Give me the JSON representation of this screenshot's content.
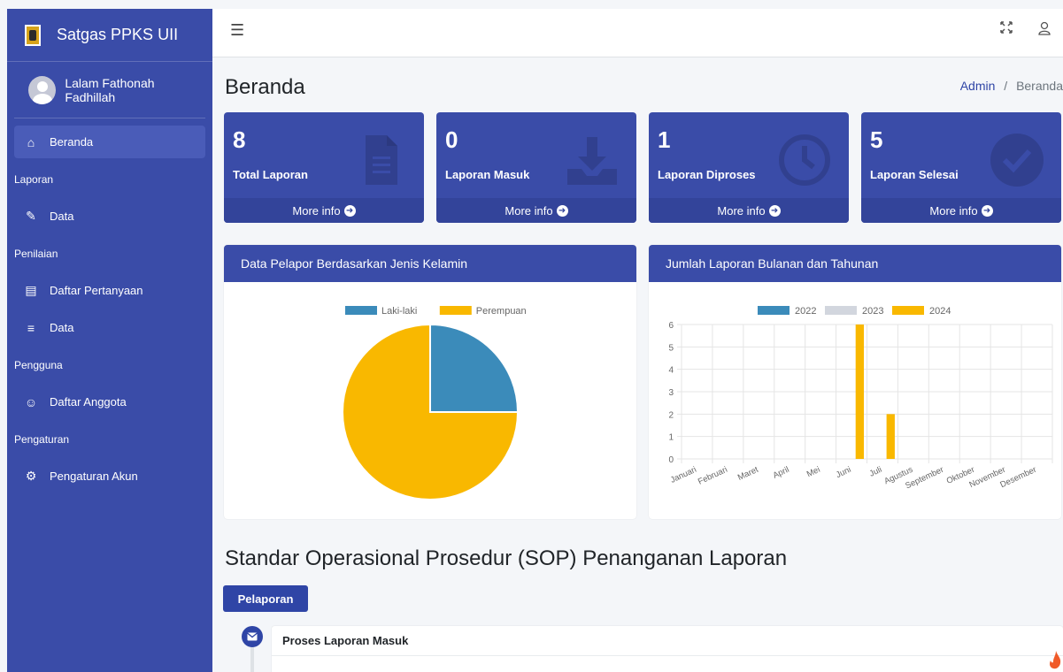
{
  "sidebar": {
    "brand": "Satgas PPKS UII",
    "user": "Lalam Fathonah Fadhillah",
    "items": [
      {
        "type": "item",
        "label": "Beranda",
        "icon": "home-icon",
        "active": true
      },
      {
        "type": "header",
        "label": "Laporan"
      },
      {
        "type": "item",
        "label": "Data",
        "icon": "chart-edit-icon"
      },
      {
        "type": "header",
        "label": "Penilaian"
      },
      {
        "type": "item",
        "label": "Daftar Pertanyaan",
        "icon": "clipboard-icon"
      },
      {
        "type": "item",
        "label": "Data",
        "icon": "database-icon"
      },
      {
        "type": "header",
        "label": "Pengguna"
      },
      {
        "type": "item",
        "label": "Daftar Anggota",
        "icon": "user-cog-icon"
      },
      {
        "type": "header",
        "label": "Pengaturan"
      },
      {
        "type": "item",
        "label": "Pengaturan Akun",
        "icon": "gear-icon"
      }
    ]
  },
  "topbar": {
    "menu_icon": "hamburger-icon",
    "fullscreen_icon": "expand-icon",
    "user_icon": "user-icon"
  },
  "page": {
    "title": "Beranda",
    "breadcrumb": {
      "link": "Admin",
      "separator": "/",
      "current": "Beranda"
    }
  },
  "boxes": [
    {
      "count": "8",
      "label": "Total Laporan",
      "icon": "file-icon"
    },
    {
      "count": "0",
      "label": "Laporan Masuk",
      "icon": "download-icon"
    },
    {
      "count": "1",
      "label": "Laporan Diproses",
      "icon": "clock-icon"
    },
    {
      "count": "5",
      "label": "Laporan Selesai",
      "icon": "check-circle-icon"
    }
  ],
  "more_info": "More info",
  "charts": {
    "gender": {
      "title": "Data Pelapor Berdasarkan Jenis Kelamin"
    },
    "monthly": {
      "title": "Jumlah Laporan Bulanan dan Tahunan"
    }
  },
  "chart_data": [
    {
      "type": "pie",
      "labels": [
        "Laki-laki",
        "Perempuan"
      ],
      "values": [
        2,
        6
      ],
      "colors": [
        "#3b8bba",
        "#f9b800"
      ],
      "legend": "top"
    },
    {
      "type": "bar",
      "categories": [
        "Januari",
        "Februari",
        "Maret",
        "April",
        "Mei",
        "Juni",
        "Juli",
        "Agustus",
        "September",
        "Oktober",
        "November",
        "Desember"
      ],
      "series": [
        {
          "name": "2022",
          "color": "#3b8bba",
          "values": [
            0,
            0,
            0,
            0,
            0,
            0,
            0,
            0,
            0,
            0,
            0,
            0
          ]
        },
        {
          "name": "2023",
          "color": "#d2d6de",
          "values": [
            0,
            0,
            0,
            0,
            0,
            0,
            0,
            0,
            0,
            0,
            0,
            0
          ]
        },
        {
          "name": "2024",
          "color": "#f9b800",
          "values": [
            0,
            0,
            0,
            0,
            0,
            6,
            2,
            0,
            0,
            0,
            0,
            0
          ]
        }
      ],
      "yticks": [
        0,
        1,
        2,
        3,
        4,
        5,
        6
      ],
      "ylim": [
        0,
        6
      ],
      "grid": true,
      "legend": "top"
    }
  ],
  "sop": {
    "title": "Standar Operasional Prosedur (SOP) Penanganan Laporan",
    "tab": "Pelaporan",
    "step_title": "Proses Laporan Masuk",
    "step_icon": "envelope-icon"
  }
}
